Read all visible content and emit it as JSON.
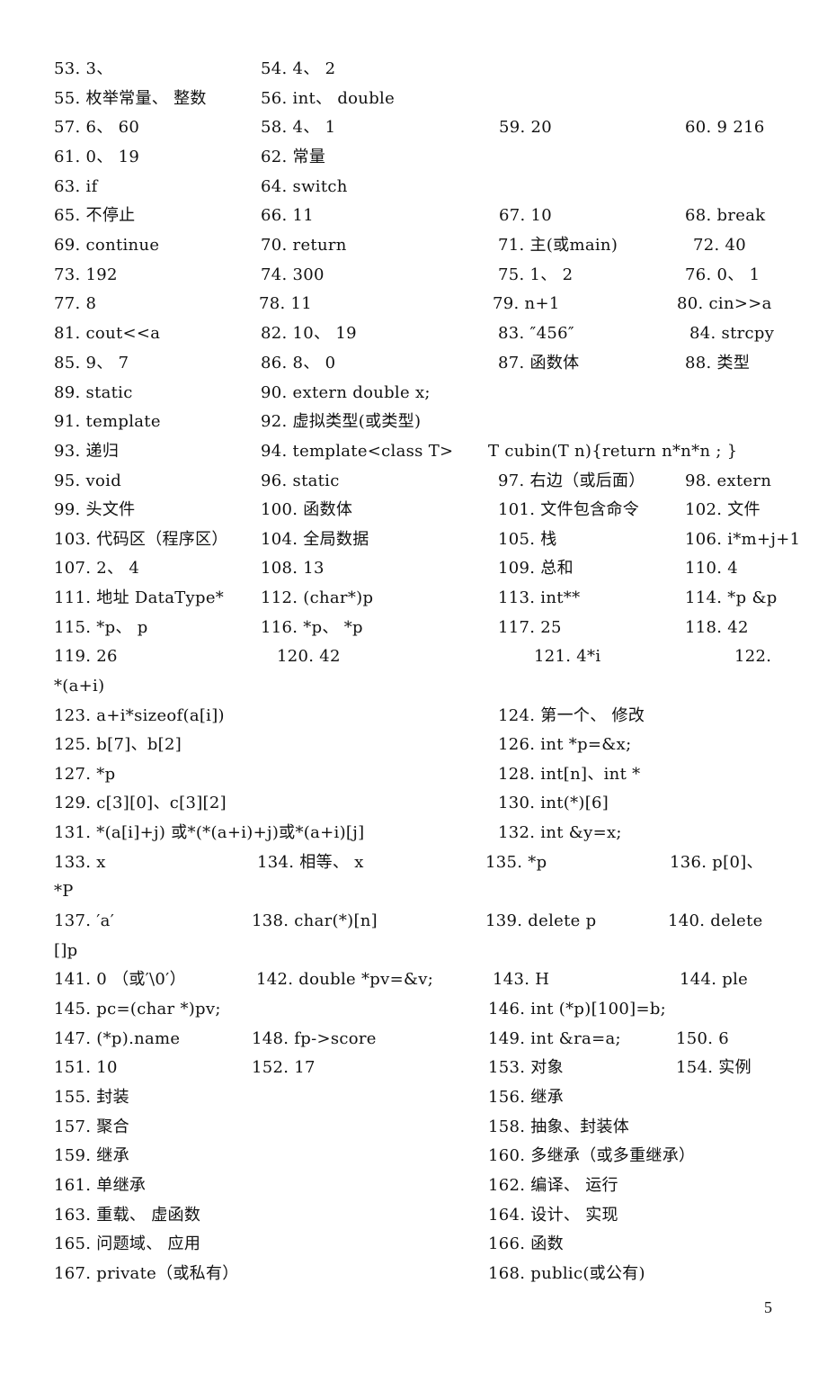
{
  "document": {
    "page_number": "5",
    "lines": [
      {
        "cells": [
          "53. 3、",
          "54. 4、 2",
          "",
          ""
        ]
      },
      {
        "cells": [
          "55. 枚举常量、 整数",
          "56. int、 double",
          "",
          ""
        ]
      },
      {
        "cells": [
          "57. 6、 60",
          "58. 4、 1",
          "59. 20",
          "60. 9 216"
        ]
      },
      {
        "cells": [
          "61. 0、 19",
          "62. 常量",
          "",
          ""
        ]
      },
      {
        "cells": [
          "63. if",
          "64. switch",
          "",
          ""
        ]
      },
      {
        "cells": [
          "65. 不停止",
          "66. 11",
          "67. 10",
          "68. break"
        ]
      },
      {
        "cells": [
          "69. continue",
          "70. return",
          "71. 主(或main)",
          "72. 40"
        ]
      },
      {
        "cells": [
          "73. 192",
          "74. 300",
          "75. 1、 2",
          "76. 0、 1"
        ]
      },
      {
        "cells": [
          "77. 8",
          "78. 11",
          "79. n+1",
          "80. cin>>a"
        ]
      },
      {
        "cells": [
          "81. cout<<a",
          "82. 10、 19",
          "83. ″456″",
          "84. strcpy"
        ]
      },
      {
        "cells": [
          "85. 9、 7",
          "86. 8、 0",
          "87. 函数体",
          "88. 类型"
        ]
      },
      {
        "cells": [
          "89. static",
          "90. extern double x;",
          "",
          ""
        ]
      },
      {
        "cells": [
          "91. template",
          "92. 虚拟类型(或类型)",
          "",
          ""
        ]
      },
      {
        "cells": [
          "93. 递归",
          "94. template<class T>",
          "T cubin(T n){return n*n*n ; }",
          ""
        ]
      },
      {
        "cells": [
          "95. void",
          "96. static",
          "97. 右边（或后面）",
          "98. extern"
        ]
      },
      {
        "cells": [
          "99. 头文件",
          "100. 函数体",
          "101. 文件包含命令",
          "102. 文件"
        ]
      },
      {
        "cells": [
          "103. 代码区（程序区）",
          "104. 全局数据",
          "105. 栈",
          "106. i*m+j+1"
        ]
      },
      {
        "cells": [
          "107. 2、 4",
          "108. 13",
          "109. 总和",
          "110. 4"
        ]
      },
      {
        "cells": [
          "111. 地址 DataType*",
          "112. (char*)p",
          "113. int**",
          "114. *p &p"
        ]
      },
      {
        "cells": [
          "115. *p、 p",
          "116. *p、 *p",
          "117. 25",
          "118. 42"
        ]
      },
      {
        "cells": [
          "119. 26",
          "120. 42",
          "121. 4*i",
          "122."
        ]
      },
      {
        "cells": [
          "*(a+i)",
          "",
          "",
          ""
        ]
      },
      {
        "cells": [
          "123. a+i*sizeof(a[i])",
          "",
          "124. 第一个、 修改",
          ""
        ]
      },
      {
        "cells": [
          "125. b[7]、b[2]",
          "",
          "126. int *p=&x;",
          ""
        ]
      },
      {
        "cells": [
          "127. *p",
          "",
          "128. int[n]、int *",
          ""
        ]
      },
      {
        "cells": [
          "129. c[3][0]、c[3][2]",
          "",
          "130. int(*)[6]",
          ""
        ]
      },
      {
        "cells": [
          "131. *(a[i]+j) 或*(*(a+i)+j)或*(a+i)[j]",
          "",
          "132. int &y=x;",
          ""
        ]
      },
      {
        "cells": [
          "133. x",
          "134. 相等、 x",
          "135. *p",
          "136. p[0]、"
        ]
      },
      {
        "cells": [
          "*P",
          "",
          "",
          ""
        ]
      },
      {
        "cells": [
          "137. ′a′",
          "138. char(*)[n]",
          "139. delete p",
          "140. delete"
        ]
      },
      {
        "cells": [
          "[]p",
          "",
          "",
          ""
        ]
      },
      {
        "cells": [
          "141. 0 （或′\\0′）",
          "142. double *pv=&v;",
          "143. H",
          "144. ple"
        ]
      },
      {
        "cells": [
          "145. pc=(char *)pv;",
          "",
          "146. int (*p)[100]=b;",
          ""
        ]
      },
      {
        "cells": [
          "147. (*p).name",
          "148. fp->score",
          "149. int &ra=a;",
          "150. 6"
        ]
      },
      {
        "cells": [
          "151. 10",
          "152. 17",
          "153. 对象",
          "154. 实例"
        ]
      },
      {
        "cells": [
          "155. 封装",
          "",
          "156. 继承",
          ""
        ]
      },
      {
        "cells": [
          "157. 聚合",
          "",
          "158. 抽象、封装体",
          ""
        ]
      },
      {
        "cells": [
          "159. 继承",
          "",
          "160. 多继承（或多重继承）",
          ""
        ]
      },
      {
        "cells": [
          "161. 单继承",
          "",
          "162. 编译、 运行",
          ""
        ]
      },
      {
        "cells": [
          "163. 重载、 虚函数",
          "",
          "164. 设计、 实现",
          ""
        ]
      },
      {
        "cells": [
          "165. 问题域、 应用",
          "",
          "166. 函数",
          ""
        ]
      },
      {
        "cells": [
          "167. private（或私有）",
          "",
          "168. public(或公有)",
          ""
        ]
      }
    ]
  }
}
